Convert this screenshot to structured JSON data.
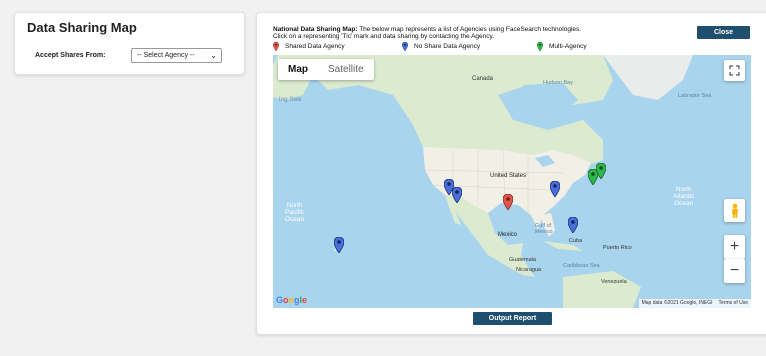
{
  "sharing": {
    "title": "Data Sharing Map",
    "accept_label": "Accept Shares From:",
    "select_value": "-- Select Agency --"
  },
  "map_panel": {
    "description_bold": "National Data Sharing Map:",
    "description_text": " The below map represents a list of Agencies using FaceSearch technologies.",
    "description_line2": "Click on a representing 'Tic' mark and data sharing by contacting the Agency.",
    "close_label": "Close",
    "legend": [
      {
        "label": "Shared Data Agency",
        "color": "#e2574c"
      },
      {
        "label": "No Share Data Agency",
        "color": "#4a6fd9"
      },
      {
        "label": "Multi-Agency",
        "color": "#2eb84b"
      }
    ],
    "output_label": "Output Report"
  },
  "map": {
    "tabs": [
      "Map",
      "Satellite"
    ],
    "active_tab": "Map",
    "labels": {
      "canada": "Canada",
      "hudson_bay": "Hudson Bay",
      "labrador_sea": "Labrador Sea",
      "united_states": "United States",
      "mexico": "Mexico",
      "gulf": "Gulf of\nMexico",
      "cuba": "Cuba",
      "puerto_rico": "Puerto Rico",
      "guatemala": "Guatemala",
      "nicaragua": "Nicaragua",
      "caribbean": "Caribbean Sea",
      "venezuela": "Venezuela",
      "north_pacific": "North\nPacific\nOcean",
      "north_atlantic": "North\nAtlantic\nOcean",
      "bering_sea": "ing Sea"
    },
    "attribution": "Map data ©2021 Google, INEGI",
    "terms": "Terms of Use",
    "google": "Google"
  },
  "colors": {
    "button": "#1f4e6e",
    "water": "#a9d4ee",
    "land": "#dcebd0",
    "us_land": "#f2efe6"
  }
}
